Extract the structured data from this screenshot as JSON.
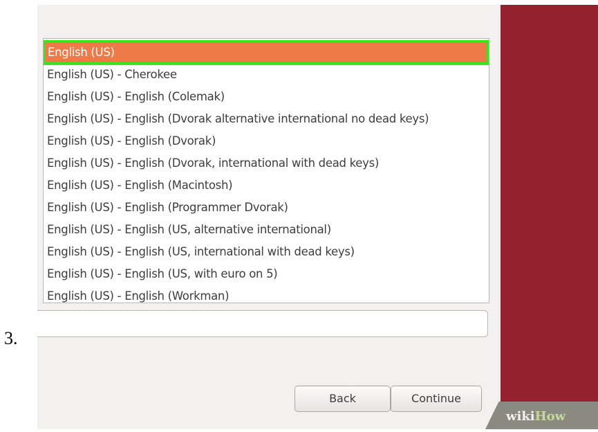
{
  "step": {
    "number": "3."
  },
  "layout_list": {
    "items": [
      "English (US)",
      "English (US) - Cherokee",
      "English (US) - English (Colemak)",
      "English (US) - English (Dvorak alternative international no dead keys)",
      "English (US) - English (Dvorak)",
      "English (US) - English (Dvorak, international with dead keys)",
      "English (US) - English (Macintosh)",
      "English (US) - English (Programmer Dvorak)",
      "English (US) - English (US, alternative international)",
      "English (US) - English (US, international with dead keys)",
      "English (US) - English (US, with euro on 5)",
      "English (US) - English (Workman)"
    ],
    "selected": "English (US)"
  },
  "test_field": {
    "value": ""
  },
  "buttons": {
    "back": "Back",
    "continue": "Continue"
  },
  "watermark": {
    "wiki": "wiki",
    "how": "How"
  },
  "colors": {
    "selection": "#ee7a48",
    "highlight_outline": "#39e41d",
    "side_panel": "#95212f",
    "dialog_bg": "#f2f1f0"
  }
}
